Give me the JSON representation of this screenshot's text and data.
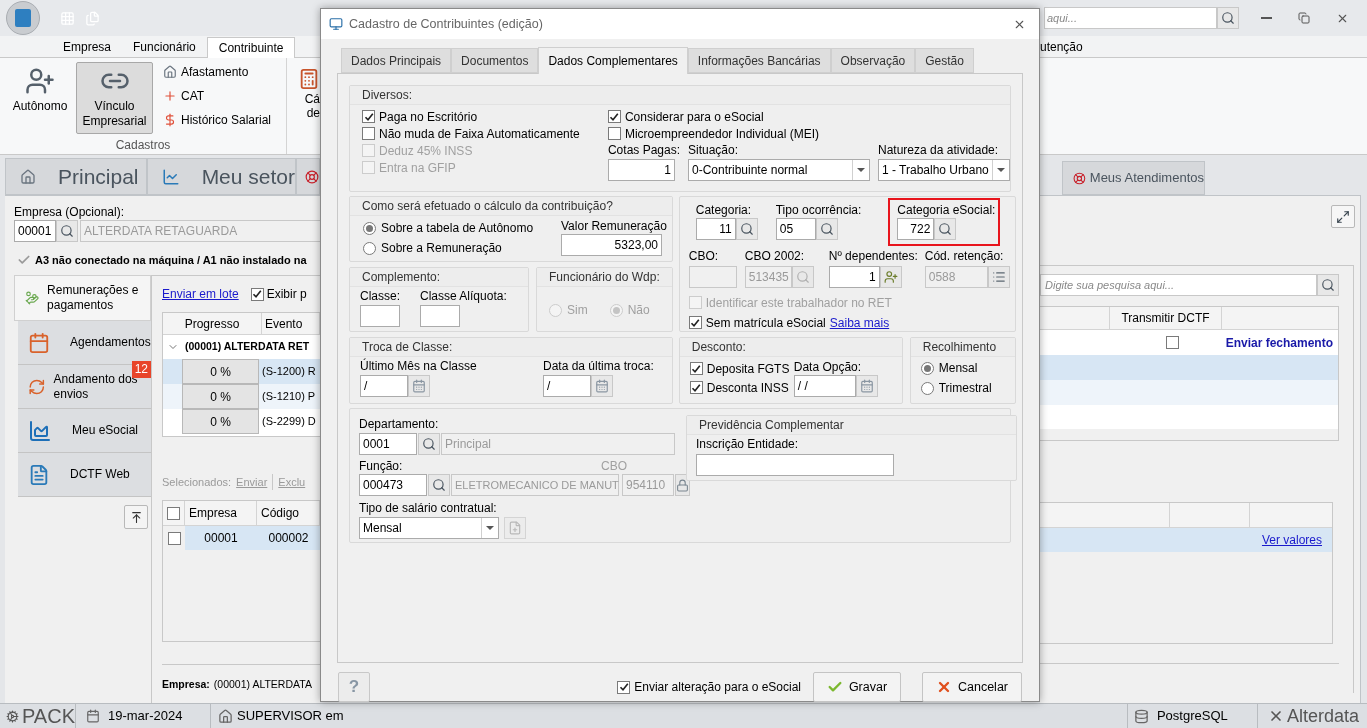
{
  "app": {
    "quick_search": {
      "placeholder": "aqui..."
    },
    "ribbon_tabs": [
      {
        "label": "Empresa",
        "selected": false
      },
      {
        "label": "Funcionário",
        "selected": false
      },
      {
        "label": "Contribuinte",
        "selected": true
      }
    ],
    "ribbon_tab_right": "utenção",
    "ribbon": {
      "large_buttons": [
        {
          "kind": "worker",
          "label": "Autônomo",
          "selected": false
        },
        {
          "kind": "link",
          "label": "Vínculo Empresarial",
          "selected": true
        }
      ],
      "small_buttons": [
        {
          "kind": "house",
          "label": "Afastamento"
        },
        {
          "kind": "cross",
          "label": "CAT"
        },
        {
          "kind": "money",
          "label": "Histórico Salarial"
        }
      ],
      "cut_button_lines": [
        "Cá",
        "de"
      ],
      "group_label": "Cadastros"
    },
    "main_tabs": [
      {
        "kind": "home",
        "label": "Principal"
      },
      {
        "kind": "chart",
        "label": "Meu setor"
      }
    ],
    "main_tab_right": "Meus Atendimentos",
    "empresa": {
      "label": "Empresa (Opcional):",
      "code": "00001",
      "name": "ALTERDATA RETAGUARDA"
    },
    "certificate_message": "A3 não conectado na máquina / A1 não instalado na",
    "nav": [
      {
        "kind": "money",
        "label": "Remunerações e pagamentos",
        "selected": true
      },
      {
        "kind": "calendar",
        "label": "Agendamentos",
        "selected": false
      },
      {
        "kind": "cycle",
        "label": "Andamento dos envios",
        "selected": false,
        "badge": "12"
      },
      {
        "kind": "area",
        "label": "Meu eSocial",
        "selected": false
      },
      {
        "kind": "dctf",
        "label": "DCTF Web",
        "selected": false
      }
    ],
    "lote_link": "Enviar em lote",
    "exibir": {
      "label": "Exibir p",
      "checked": true
    },
    "events_table": {
      "columns": [
        "Progresso",
        "Evento"
      ],
      "group": "(00001) ALTERDATA RET",
      "rows": [
        {
          "progress": "0 %",
          "event": "(S-1200) R"
        },
        {
          "progress": "0 %",
          "event": "(S-1210) P"
        },
        {
          "progress": "0 %",
          "event": "(S-2299) D"
        }
      ],
      "right_column": "Transmitir DCTF",
      "right_checked": false,
      "right_link": "Enviar fechamento"
    },
    "search": {
      "placeholder": "Digite sua pesquisa aqui..."
    },
    "selecionados": {
      "label": "Selecionados:",
      "actions": [
        "Enviar",
        "Exclu"
      ]
    },
    "companies_table": {
      "columns": [
        "Empresa",
        "Código"
      ],
      "header_checked": false,
      "rows": [
        {
          "checked": false,
          "cells": [
            "00001",
            "000002"
          ],
          "link": "Ver valores"
        }
      ]
    },
    "footer": {
      "label": "Empresa:",
      "value": "(00001) ALTERDATA"
    },
    "status_bar": {
      "product": "PACK",
      "date": "19-mar-2024",
      "user": "SUPERVISOR em",
      "database": "PostgreSQL",
      "brand": "Alterdata"
    }
  },
  "dialog": {
    "title": "Cadastro de Contribuintes (edição)",
    "tabs": [
      {
        "label": "Dados Principais",
        "selected": false
      },
      {
        "label": "Documentos",
        "selected": false
      },
      {
        "label": "Dados Complementares",
        "selected": true
      },
      {
        "label": "Informações Bancárias",
        "selected": false
      },
      {
        "label": "Observação",
        "selected": false
      },
      {
        "label": "Gestão",
        "selected": false
      }
    ],
    "diversos": {
      "title": "Diversos:",
      "left_checks": [
        {
          "label": "Paga no Escritório",
          "checked": true,
          "disabled": false
        },
        {
          "label": "Não muda de Faixa Automaticamente",
          "checked": false,
          "disabled": false
        },
        {
          "label": "Deduz 45% INSS",
          "checked": false,
          "disabled": true
        },
        {
          "label": "Entra na GFIP",
          "checked": false,
          "disabled": true
        }
      ],
      "right_checks": [
        {
          "label": "Considerar para o eSocial",
          "checked": true,
          "disabled": false
        },
        {
          "label": "Microempreendedor Individual (MEI)",
          "checked": false,
          "disabled": false
        }
      ],
      "cotas": {
        "label": "Cotas Pagas:",
        "value": "1"
      },
      "situacao": {
        "label": "Situação:",
        "value": "0-Contribuinte normal"
      },
      "natureza": {
        "label": "Natureza da atividade:",
        "value": "1 - Trabalho Urbano"
      }
    },
    "calculo": {
      "title": "Como será efetuado o cálculo da contribuição?",
      "options": [
        {
          "label": "Sobre a tabela de Autônomo",
          "selected": true
        },
        {
          "label": "Sobre a Remuneração",
          "selected": false
        }
      ],
      "valor": {
        "label": "Valor Remuneração",
        "value": "5323,00"
      }
    },
    "complemento": {
      "title": "Complemento:",
      "fields": [
        {
          "label": "Classe:"
        },
        {
          "label": "Classe Alíquota:"
        }
      ]
    },
    "wdp": {
      "title": "Funcionário do Wdp:",
      "disabled": true,
      "options": [
        {
          "label": "Sim",
          "selected": false
        },
        {
          "label": "Não",
          "selected": true
        }
      ]
    },
    "troca": {
      "title": "Troca de Classe:",
      "fields": [
        {
          "label": "Último Mês na Classe",
          "value": "/"
        },
        {
          "label": "Data da última troca:",
          "value": "/"
        }
      ]
    },
    "categoria": {
      "row1": [
        {
          "label": "Categoria:",
          "value": "11",
          "highlighted": false
        },
        {
          "label": "Tipo ocorrência:",
          "value": "05",
          "highlighted": false
        },
        {
          "label": "Categoria eSocial:",
          "value": "722",
          "highlighted": true
        }
      ],
      "row2": [
        {
          "kind": "plain",
          "label": "CBO:",
          "disabled": true
        },
        {
          "kind": "lookup",
          "label": "CBO 2002:",
          "value": "513435",
          "disabled": true
        },
        {
          "kind": "people",
          "label": "Nº dependentes:",
          "value": "1",
          "disabled": false
        },
        {
          "kind": "list",
          "label": "Cód. retenção:",
          "value": "0588",
          "disabled": true
        }
      ],
      "checks": [
        {
          "label": "Identificar este trabalhador no RET",
          "checked": false,
          "disabled": true
        },
        {
          "label": "Sem matrícula eSocial",
          "checked": true,
          "disabled": false,
          "link": "Saiba mais"
        }
      ]
    },
    "desconto": {
      "title": "Desconto:",
      "checks": [
        {
          "label": "Deposita FGTS",
          "checked": true,
          "disabled": false
        },
        {
          "label": "Desconta INSS",
          "checked": true,
          "disabled": false
        }
      ],
      "data_opcao": {
        "label": "Data Opção:",
        "value": "/ /"
      }
    },
    "recolhimento": {
      "title": "Recolhimento",
      "options": [
        {
          "label": "Mensal",
          "selected": true
        },
        {
          "label": "Trimestral",
          "selected": false
        }
      ]
    },
    "departamento": {
      "label": "Departamento:",
      "code": "0001",
      "name": "Principal"
    },
    "funcao": {
      "label": "Função:",
      "code": "000473",
      "name": "ELETROMECANICO DE MANUT",
      "cbo_label": "CBO",
      "cbo": "954110"
    },
    "tipo_salario": {
      "label": "Tipo de salário contratual:",
      "value": "Mensal"
    },
    "previdencia": {
      "title": "Previdência Complementar",
      "field_label": "Inscrição Entidade:"
    },
    "footer": {
      "help": "?",
      "send_check": {
        "label": "Enviar alteração para o eSocial",
        "checked": true
      },
      "buttons": [
        {
          "kind": "save",
          "label": "Gravar"
        },
        {
          "kind": "cancel",
          "label": "Cancelar"
        }
      ]
    }
  }
}
